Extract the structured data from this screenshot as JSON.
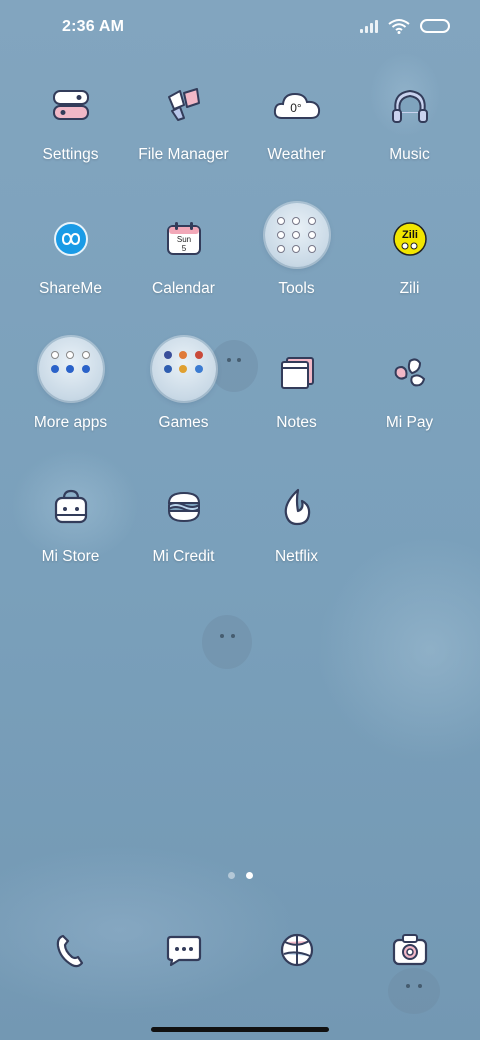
{
  "status_bar": {
    "time": "2:36 AM",
    "icons": [
      "signal-icon",
      "wifi-icon",
      "battery-icon"
    ]
  },
  "apps": [
    {
      "id": "settings",
      "label": "Settings",
      "icon": "settings-icon"
    },
    {
      "id": "file-manager",
      "label": "File Manager",
      "icon": "file-manager-icon"
    },
    {
      "id": "weather",
      "label": "Weather",
      "icon": "weather-icon",
      "icon_text": "0°"
    },
    {
      "id": "music",
      "label": "Music",
      "icon": "headphones-icon"
    },
    {
      "id": "shareme",
      "label": "ShareMe",
      "icon": "shareme-icon"
    },
    {
      "id": "calendar",
      "label": "Calendar",
      "icon": "calendar-icon",
      "icon_text_day": "Sun",
      "icon_text_date": "5"
    },
    {
      "id": "tools",
      "label": "Tools",
      "icon": "folder-icon"
    },
    {
      "id": "zili",
      "label": "Zili",
      "icon": "zili-icon",
      "icon_text": "Zili"
    },
    {
      "id": "more-apps",
      "label": "More apps",
      "icon": "folder-icon"
    },
    {
      "id": "games",
      "label": "Games",
      "icon": "folder-icon"
    },
    {
      "id": "notes",
      "label": "Notes",
      "icon": "notes-icon"
    },
    {
      "id": "mi-pay",
      "label": "Mi Pay",
      "icon": "mi-pay-icon"
    },
    {
      "id": "mi-store",
      "label": "Mi Store",
      "icon": "bag-icon"
    },
    {
      "id": "mi-credit",
      "label": "Mi Credit",
      "icon": "mi-credit-icon"
    },
    {
      "id": "netflix",
      "label": "Netflix",
      "icon": "flame-icon"
    }
  ],
  "page_indicator": {
    "count": 2,
    "active": 2
  },
  "dock": [
    {
      "id": "phone",
      "icon": "phone-icon"
    },
    {
      "id": "messages",
      "icon": "messages-icon"
    },
    {
      "id": "browser",
      "icon": "browser-ball-icon"
    },
    {
      "id": "camera",
      "icon": "camera-icon"
    }
  ],
  "colors": {
    "wallpaper": "#7fa3bd",
    "label_text": "#ffffff",
    "shareme_blue": "#1a9be6",
    "zili_yellow": "#f2e600",
    "calendar_pink": "#f2a8b8"
  }
}
